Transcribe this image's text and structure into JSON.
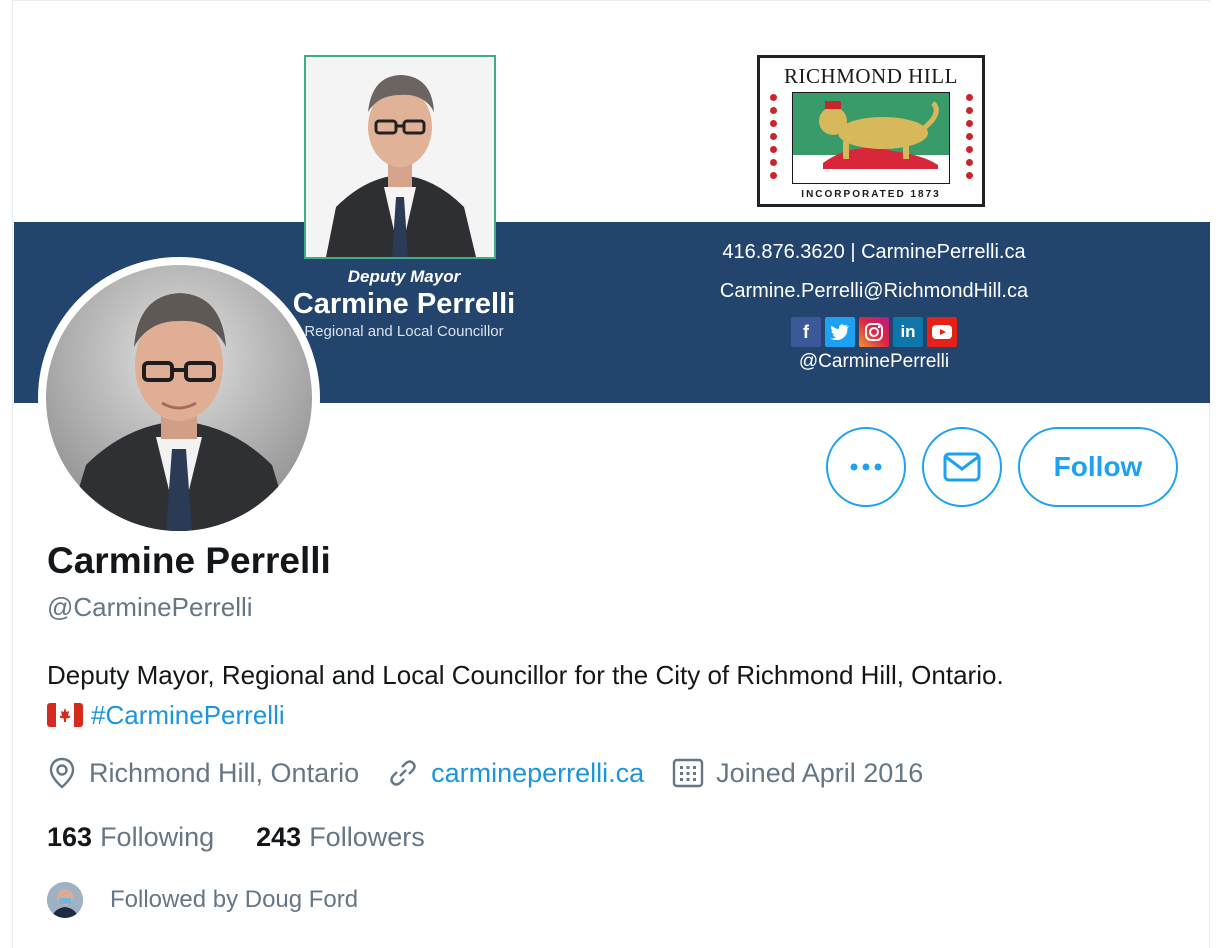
{
  "banner": {
    "caption_role": "Deputy Mayor",
    "caption_name": "Carmine Perrelli",
    "caption_sub": "Regional and Local Councillor",
    "logo_title": "RICHMOND HILL",
    "logo_incorporated": "INCORPORATED 1873",
    "phone_and_site": "416.876.3620  |  CarminePerrelli.ca",
    "email": "Carmine.Perrelli@RichmondHill.ca",
    "social_handle": "@CarminePerrelli",
    "social_icons": [
      "facebook-icon",
      "twitter-icon",
      "instagram-icon",
      "linkedin-icon",
      "youtube-icon"
    ],
    "band_color": "#23446d"
  },
  "actions": {
    "more_label": "More",
    "message_label": "Message",
    "follow_label": "Follow",
    "accent": "#1da1f2"
  },
  "profile": {
    "name": "Carmine Perrelli",
    "handle": "@CarminePerrelli",
    "bio": "Deputy Mayor, Regional and Local Councillor for the City of Richmond Hill, Ontario.",
    "hashtag": "#CarminePerrelli",
    "location": "Richmond Hill, Ontario",
    "website": "carmineperrelli.ca",
    "joined": "Joined April 2016"
  },
  "stats": {
    "following_count": "163",
    "following_label": "Following",
    "followers_count": "243",
    "followers_label": "Followers"
  },
  "followed_by": {
    "text": "Followed by Doug Ford"
  }
}
